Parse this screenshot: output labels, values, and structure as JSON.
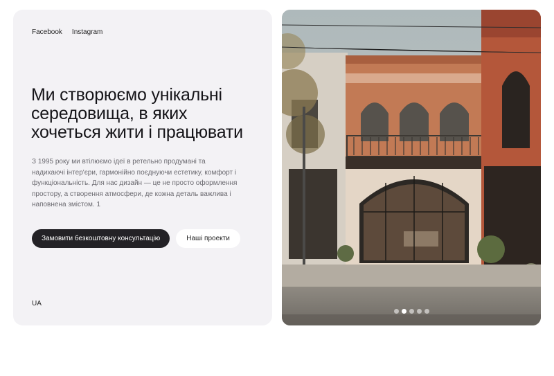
{
  "social": {
    "facebook": "Facebook",
    "instagram": "Instagram"
  },
  "hero": {
    "title_line1": "Ми створюємо унікальні",
    "title_line2": "середовища, в яких",
    "title_line3": "хочеться жити і працювати",
    "description": "З 1995 року ми втілюємо ідеї в ретельно продумані та надихаючі інтер'єри, гармонійно поєднуючи естетику, комфорт і функціональність. Для нас дизайн — це не просто оформлення простору, а створення атмосфери, де кожна деталь важлива і наповнена змістом. 1"
  },
  "buttons": {
    "primary": "Замовити безкоштовну консультацію",
    "secondary": "Наші проекти"
  },
  "language": "UA",
  "carousel": {
    "slides": 5,
    "active_index": 1
  }
}
